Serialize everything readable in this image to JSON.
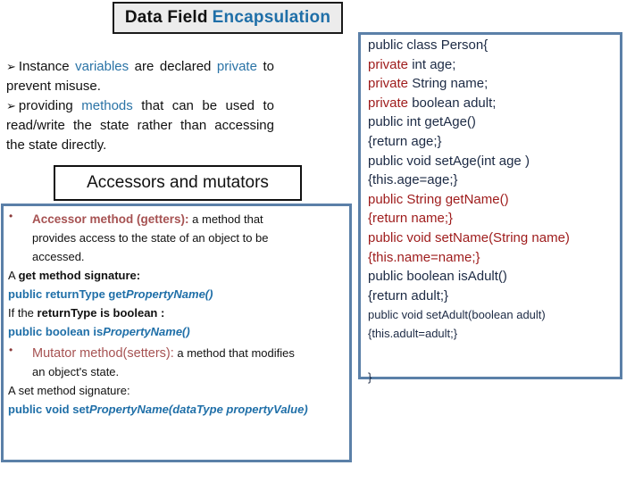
{
  "title": {
    "part1": "Data Field",
    "part2": "Encapsulation"
  },
  "intro": {
    "bullet_glyph": "➢",
    "p1": {
      "t1": "Instance ",
      "hl1": "variables",
      "t2": " are declared ",
      "hl2": "private",
      "t3": " to prevent misuse."
    },
    "p2": {
      "t1": "providing ",
      "hl1": "methods",
      "t2": " that can be used to read/write the state rather than accessing the state directly."
    }
  },
  "subheading": "Accessors and mutators",
  "left_panel": {
    "bullet_glyph": "•",
    "accessor": {
      "label": "Accessor method  (getters):",
      "desc_line1": " a method that",
      "desc_line2": "provides access to the state of an object to be",
      "desc_line3": "accessed."
    },
    "get_sig_intro": {
      "t1": "A ",
      "b1": "get method  signature:"
    },
    "get_sig": {
      "prefix": "public returnType get",
      "italic": "PropertyName()"
    },
    "bool_intro": {
      "t1": "If the ",
      "b1": "returnType is boolean :"
    },
    "bool_sig": {
      "prefix": "public boolean is",
      "italic": "PropertyName()"
    },
    "mutator": {
      "label": "Mutator method(setters):",
      "desc_line1": " a method that modifies",
      "desc_line2": "an object's state."
    },
    "set_sig_intro": "A set method signature:",
    "set_sig": {
      "prefix": "public void set",
      "italic": "PropertyName(dataType   propertyValue)"
    }
  },
  "code_panel": {
    "lines": [
      {
        "kw": "",
        "rest": "public class Person{",
        "color": "dark"
      },
      {
        "kw": "private",
        "rest": " int age;",
        "color": "dark"
      },
      {
        "kw": "private",
        "rest": " String name;",
        "color": "dark"
      },
      {
        "kw": "private",
        "rest": " boolean adult;",
        "color": "dark"
      },
      {
        "kw": "",
        "rest": "public int getAge()",
        "color": "dark"
      },
      {
        "kw": "",
        "rest": "{return age;}",
        "color": "dark"
      },
      {
        "kw": "",
        "rest": "public void  setAge(int age )",
        "color": "dark"
      },
      {
        "kw": "",
        "rest": "{this.age=age;}",
        "color": "dark"
      },
      {
        "kw": "",
        "rest": "public String getName()",
        "color": "red"
      },
      {
        "kw": "",
        "rest": "{return name;}",
        "color": "red"
      },
      {
        "kw": "",
        "rest": "public void  setName(String name)",
        "color": "red"
      },
      {
        "kw": "",
        "rest": "{this.name=name;}",
        "color": "red"
      },
      {
        "kw": "",
        "rest": "public boolean isAdult()",
        "color": "dark"
      },
      {
        "kw": "",
        "rest": "{return adult;}",
        "color": "dark"
      },
      {
        "kw": "",
        "rest": "public void setAdult(boolean adult)",
        "color": "dark",
        "small": true
      },
      {
        "kw": "",
        "rest": "{this.adult=adult;}",
        "color": "dark",
        "small": true
      }
    ],
    "closing": "}"
  },
  "colors": {
    "accent_blue": "#1f6fa8",
    "panel_border": "#5b80a8",
    "keyword_red": "#9e1b1b",
    "label_red": "#a65252",
    "code_text": "#1c2a44"
  }
}
